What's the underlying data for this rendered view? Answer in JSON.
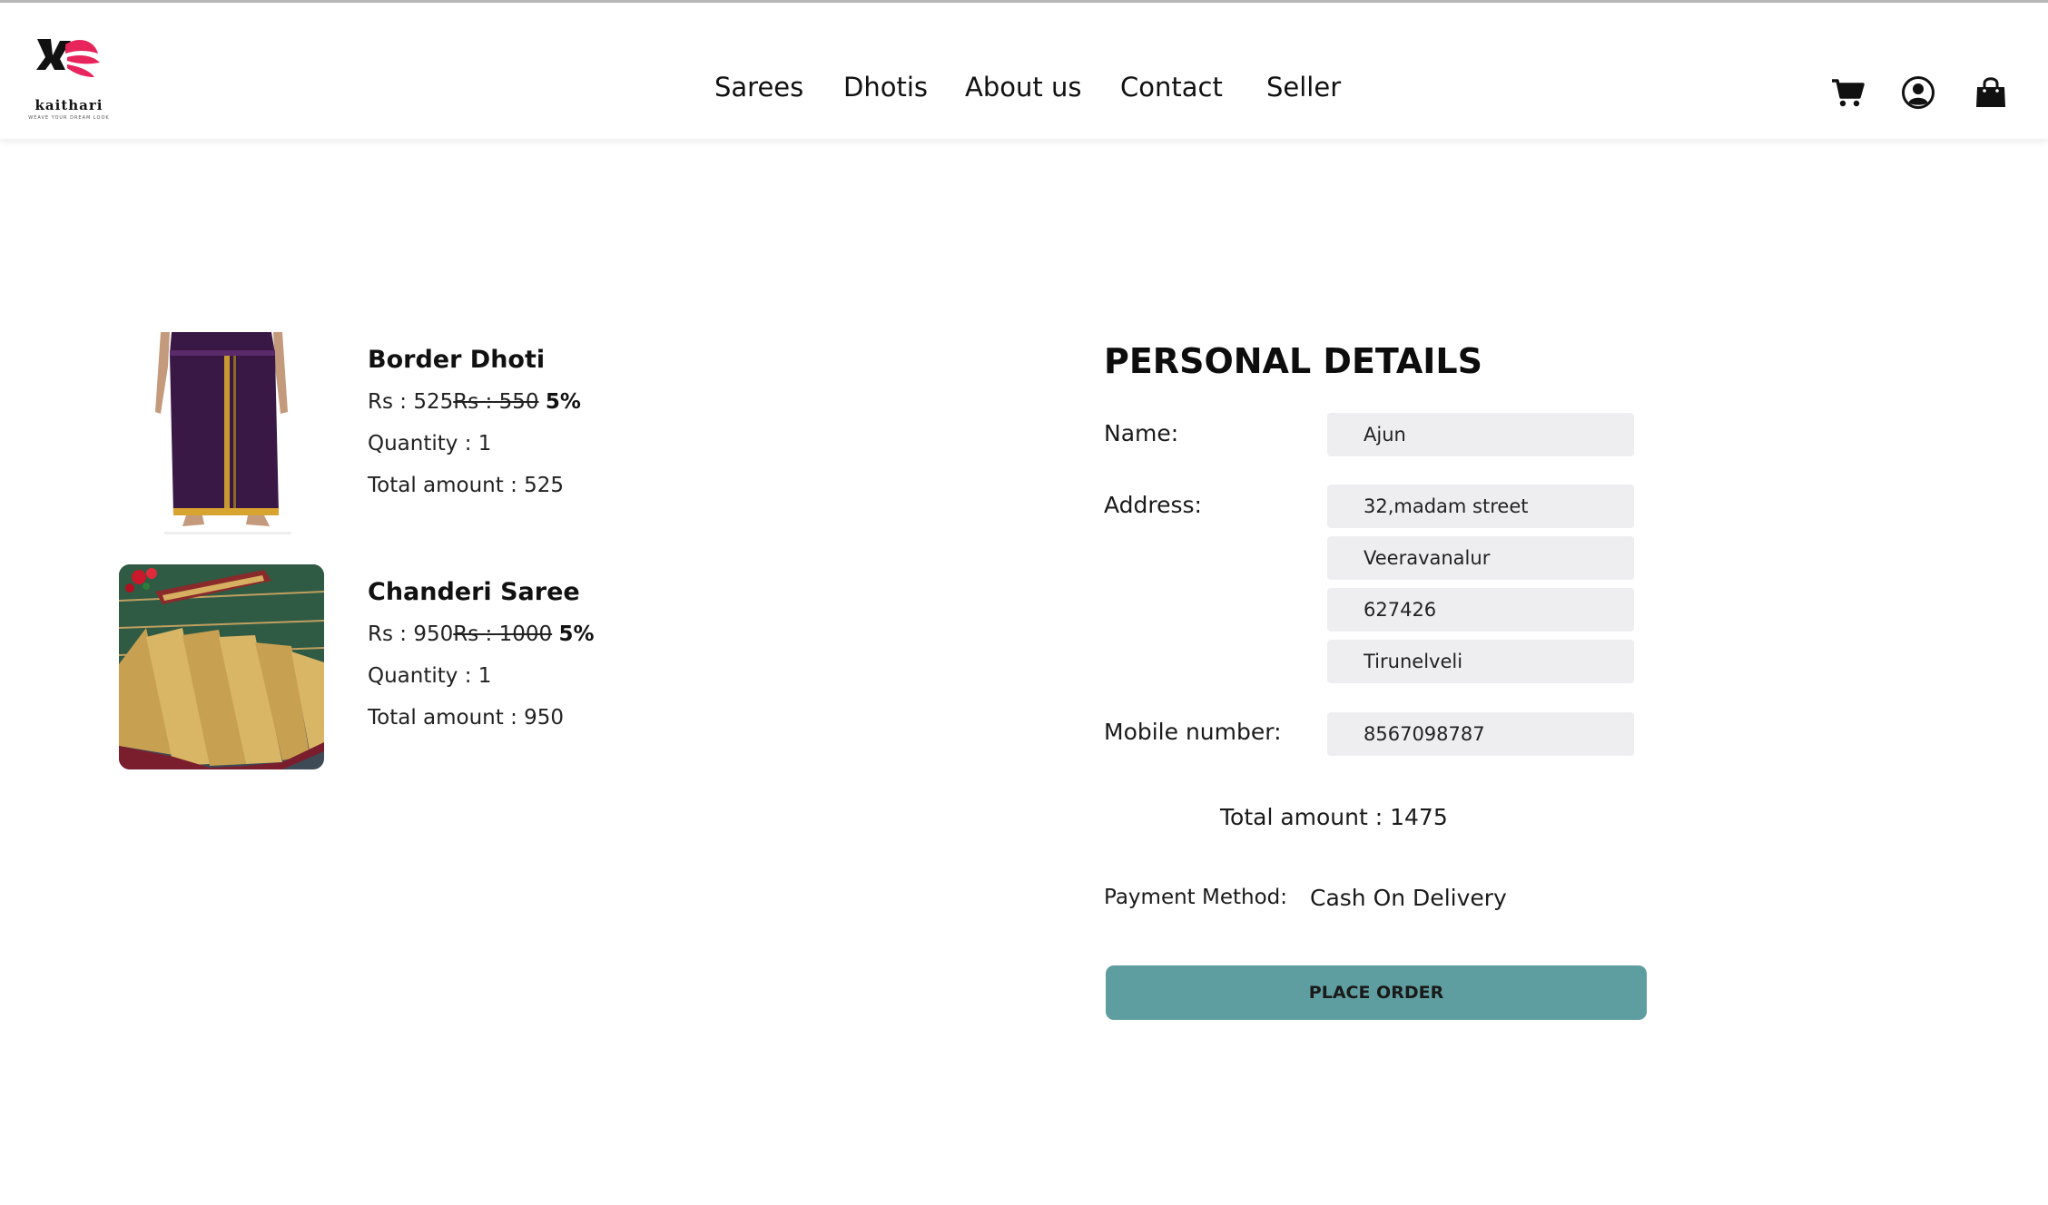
{
  "brand": {
    "name": "kaithari",
    "tagline": "WEAVE YOUR DREAM LOOK",
    "accent_color": "#e8245c"
  },
  "nav": {
    "items": [
      "Sarees",
      "Dhotis",
      "About us",
      "Contact",
      "Seller"
    ]
  },
  "header_icons": [
    "cart-icon",
    "user-account-icon",
    "shopping-bag-icon"
  ],
  "cart": {
    "items": [
      {
        "name": "Border Dhoti",
        "price_prefix": "Rs : 525",
        "old_price": "Rs : 550",
        "discount": "5%",
        "quantity": "Quantity : 1",
        "total": "Total amount : 525"
      },
      {
        "name": "Chanderi Saree",
        "price_prefix": "Rs : 950",
        "old_price": "Rs : 1000",
        "discount": "5%",
        "quantity": "Quantity : 1",
        "total": "Total amount : 950"
      }
    ]
  },
  "personal_details": {
    "title": "PERSONAL DETAILS",
    "name_label": "Name:",
    "name_value": "Ajun",
    "address_label": "Address:",
    "address_lines": [
      "32,madam street",
      "Veeravanalur",
      "627426",
      "Tirunelveli"
    ],
    "mobile_label": "Mobile number:",
    "mobile_value": "8567098787"
  },
  "order": {
    "total": "Total amount : 1475",
    "payment_label": "Payment Method:",
    "payment_value": "Cash On Delivery",
    "place_order_label": "PLACE ORDER",
    "button_color": "#5f9ea0"
  }
}
